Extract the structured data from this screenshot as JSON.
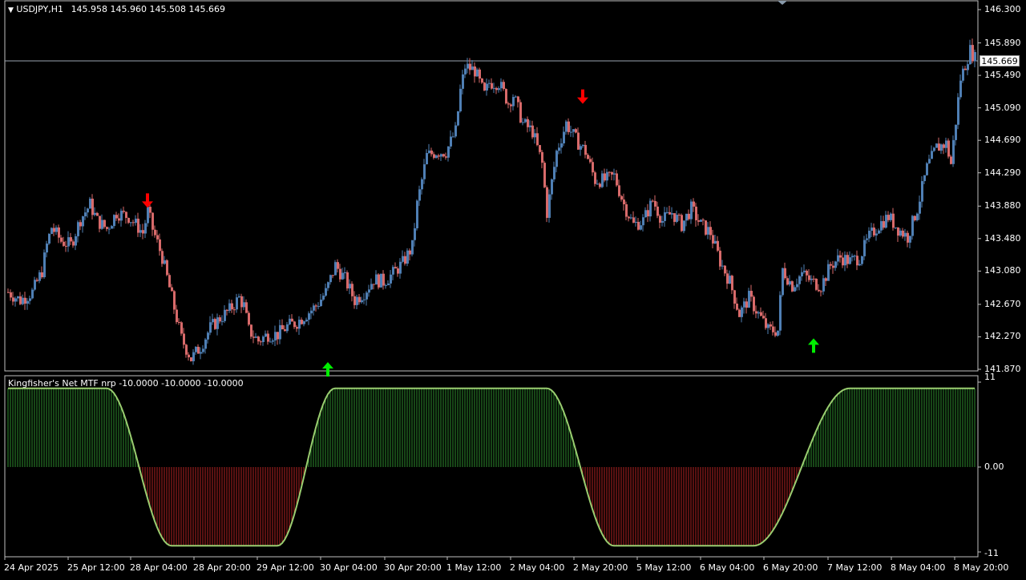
{
  "main": {
    "symbol_label": "USDJPY,H1",
    "ohlc_label": "145.958 145.960 145.508 145.669",
    "current_price": "145.669",
    "y_ticks": [
      "146.300",
      "145.890",
      "145.490",
      "145.090",
      "144.690",
      "144.290",
      "143.880",
      "143.480",
      "143.080",
      "142.670",
      "142.270",
      "141.870"
    ]
  },
  "indicator": {
    "label": "Kingfisher's Net MTF nrp -10.0000 -10.0000 -10.0000",
    "y_ticks": [
      "11",
      "0.00",
      "-11"
    ]
  },
  "x_axis": [
    "24 Apr 2025",
    "25 Apr 12:00",
    "28 Apr 04:00",
    "28 Apr 20:00",
    "29 Apr 12:00",
    "30 Apr 04:00",
    "30 Apr 20:00",
    "1 May 12:00",
    "2 May 04:00",
    "2 May 20:00",
    "5 May 12:00",
    "6 May 04:00",
    "6 May 20:00",
    "7 May 12:00",
    "8 May 04:00",
    "8 May 20:00"
  ],
  "colors": {
    "bull": "#4f7fb4",
    "bear": "#d86a6a",
    "sig_up": "#00ee00",
    "sig_down": "#ff0000",
    "ind_pos": "#2e8b2e",
    "ind_neg": "#b22222",
    "ind_line": "#9acd70",
    "axis": "#c0c0c0"
  },
  "chart_data": [
    {
      "type": "candlestick",
      "title": "USDJPY,H1",
      "ylim": [
        141.87,
        146.3
      ],
      "current_price": 145.669,
      "anchors": [
        [
          0,
          142.82
        ],
        [
          5,
          142.72
        ],
        [
          10,
          142.82
        ],
        [
          14,
          143.08
        ],
        [
          16,
          143.4
        ],
        [
          18,
          143.62
        ],
        [
          22,
          143.45
        ],
        [
          26,
          143.4
        ],
        [
          30,
          143.72
        ],
        [
          34,
          143.9
        ],
        [
          37,
          143.7
        ],
        [
          41,
          143.6
        ],
        [
          45,
          143.8
        ],
        [
          50,
          143.75
        ],
        [
          54,
          143.62
        ],
        [
          56,
          143.55
        ],
        [
          58,
          143.82
        ],
        [
          60,
          143.6
        ],
        [
          64,
          143.25
        ],
        [
          68,
          142.75
        ],
        [
          72,
          142.25
        ],
        [
          76,
          142.0
        ],
        [
          80,
          142.15
        ],
        [
          84,
          142.38
        ],
        [
          88,
          142.5
        ],
        [
          92,
          142.6
        ],
        [
          96,
          142.75
        ],
        [
          98,
          142.65
        ],
        [
          100,
          142.35
        ],
        [
          104,
          142.22
        ],
        [
          108,
          142.3
        ],
        [
          112,
          142.3
        ],
        [
          116,
          142.4
        ],
        [
          120,
          142.45
        ],
        [
          124,
          142.55
        ],
        [
          128,
          142.65
        ],
        [
          132,
          142.82
        ],
        [
          136,
          143.15
        ],
        [
          140,
          142.98
        ],
        [
          144,
          142.72
        ],
        [
          148,
          142.82
        ],
        [
          152,
          142.98
        ],
        [
          156,
          142.95
        ],
        [
          160,
          143.05
        ],
        [
          164,
          143.18
        ],
        [
          168,
          143.38
        ],
        [
          170,
          143.9
        ],
        [
          174,
          144.5
        ],
        [
          178,
          144.55
        ],
        [
          182,
          144.55
        ],
        [
          186,
          144.8
        ],
        [
          188,
          145.3
        ],
        [
          190,
          145.6
        ],
        [
          194,
          145.55
        ],
        [
          198,
          145.25
        ],
        [
          200,
          145.4
        ],
        [
          204,
          145.4
        ],
        [
          208,
          145.15
        ],
        [
          210,
          145.25
        ],
        [
          214,
          144.9
        ],
        [
          218,
          144.8
        ],
        [
          220,
          144.6
        ],
        [
          222,
          144.4
        ],
        [
          224,
          143.8
        ],
        [
          228,
          144.55
        ],
        [
          232,
          144.9
        ],
        [
          236,
          144.7
        ],
        [
          240,
          144.55
        ],
        [
          244,
          144.2
        ],
        [
          248,
          144.2
        ],
        [
          252,
          144.25
        ],
        [
          256,
          143.9
        ],
        [
          260,
          143.65
        ],
        [
          264,
          143.7
        ],
        [
          268,
          143.95
        ],
        [
          272,
          143.7
        ],
        [
          276,
          143.8
        ],
        [
          280,
          143.65
        ],
        [
          284,
          143.85
        ],
        [
          288,
          143.65
        ],
        [
          292,
          143.55
        ],
        [
          296,
          143.2
        ],
        [
          300,
          142.95
        ],
        [
          304,
          142.55
        ],
        [
          308,
          142.75
        ],
        [
          312,
          142.55
        ],
        [
          316,
          142.35
        ],
        [
          320,
          142.35
        ],
        [
          322,
          143.1
        ],
        [
          326,
          142.9
        ],
        [
          330,
          143.05
        ],
        [
          334,
          142.95
        ],
        [
          338,
          142.9
        ],
        [
          342,
          143.15
        ],
        [
          346,
          143.25
        ],
        [
          350,
          143.2
        ],
        [
          354,
          143.25
        ],
        [
          358,
          143.5
        ],
        [
          362,
          143.65
        ],
        [
          366,
          143.75
        ],
        [
          370,
          143.6
        ],
        [
          374,
          143.5
        ],
        [
          378,
          143.85
        ],
        [
          382,
          144.35
        ],
        [
          386,
          144.6
        ],
        [
          390,
          144.65
        ],
        [
          392,
          144.4
        ],
        [
          396,
          145.45
        ],
        [
          400,
          145.8
        ],
        [
          402,
          145.7
        ]
      ],
      "signals": [
        {
          "type": "sell",
          "index": 58,
          "price": 143.82
        },
        {
          "type": "buy",
          "index": 133,
          "price": 141.87
        },
        {
          "type": "sell",
          "index": 239,
          "price": 145.1
        },
        {
          "type": "buy",
          "index": 335,
          "price": 142.35
        }
      ]
    },
    {
      "type": "histogram",
      "title": "Kingfisher's Net MTF nrp",
      "ylim": [
        -11,
        11
      ],
      "segments": [
        [
          0,
          10.2
        ],
        [
          41,
          10.2
        ],
        [
          68,
          -10.2
        ],
        [
          112,
          -10.2
        ],
        [
          136,
          10.2
        ],
        [
          224,
          10.2
        ],
        [
          252,
          -10.2
        ],
        [
          310,
          -10.2
        ],
        [
          350,
          10.2
        ],
        [
          402,
          10.2
        ]
      ]
    }
  ]
}
